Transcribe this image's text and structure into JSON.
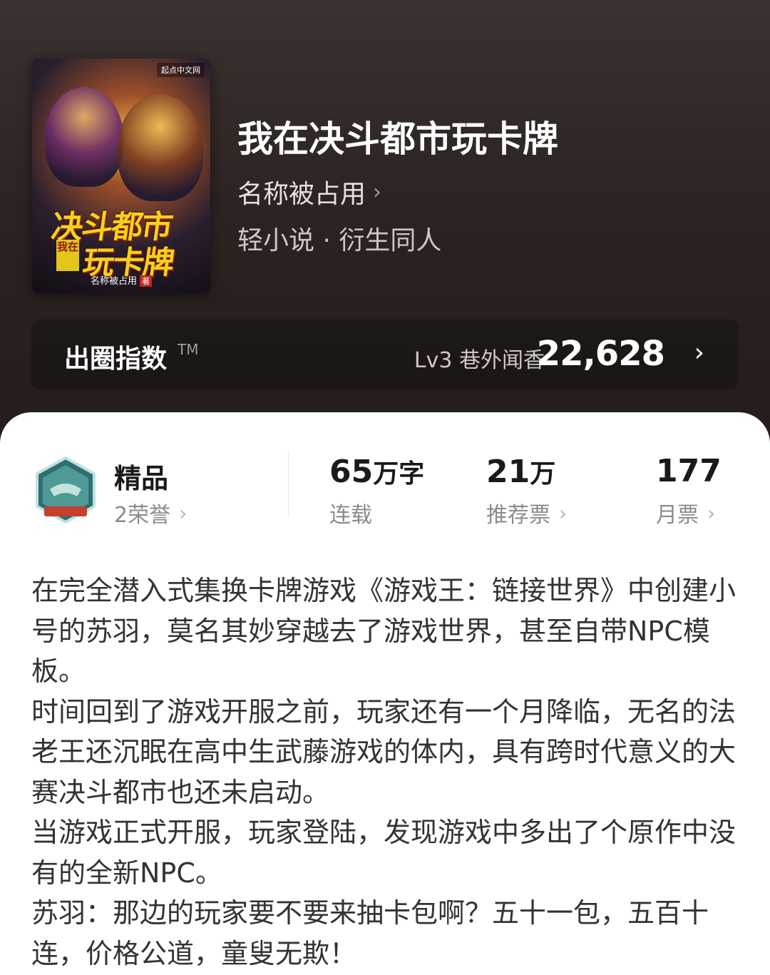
{
  "colors": {
    "hero_bg": "#2c2422",
    "cover_title": "#f4d21b",
    "text_primary": "#1a1a1a",
    "text_muted": "#8b8b8b"
  },
  "cover": {
    "publisher": "起点中文网",
    "title_line1": "决斗都市",
    "title_prefix": "我在",
    "title_line2": "玩卡牌",
    "author": "名称被占用",
    "author_suffix": "著"
  },
  "book": {
    "title": "我在决斗都市玩卡牌",
    "author": "名称被占用",
    "author_chevron": "›",
    "genre": "轻小说 · 衍生同人"
  },
  "index": {
    "label": "出圈指数",
    "tm": "TM",
    "level": "Lv3 巷外闻香",
    "value": "22,628",
    "chevron": "›"
  },
  "stats": {
    "quality": {
      "label": "精品",
      "honor": "2荣誉",
      "icon": "badge-icon"
    },
    "words": {
      "value": "65",
      "unit": "万字",
      "label": "连载"
    },
    "recommend": {
      "value": "21",
      "unit": "万",
      "label": "推荐票"
    },
    "monthly": {
      "value": "177",
      "label": "月票"
    }
  },
  "description": [
    "在完全潜入式集换卡牌游戏《游戏王：链接世界》中创建小号的苏羽，莫名其妙穿越去了游戏世界，甚至自带NPC模板。",
    "时间回到了游戏开服之前，玩家还有一个月降临，无名的法老王还沉眠在高中生武藤游戏的体内，具有跨时代意义的大赛决斗都市也还未启动。",
    "当游戏正式开服，玩家登陆，发现游戏中多出了个原作中没有的全新NPC。",
    "苏羽：那边的玩家要不要来抽卡包啊？五十一包，五百十连，价格公道，童叟无欺！"
  ]
}
